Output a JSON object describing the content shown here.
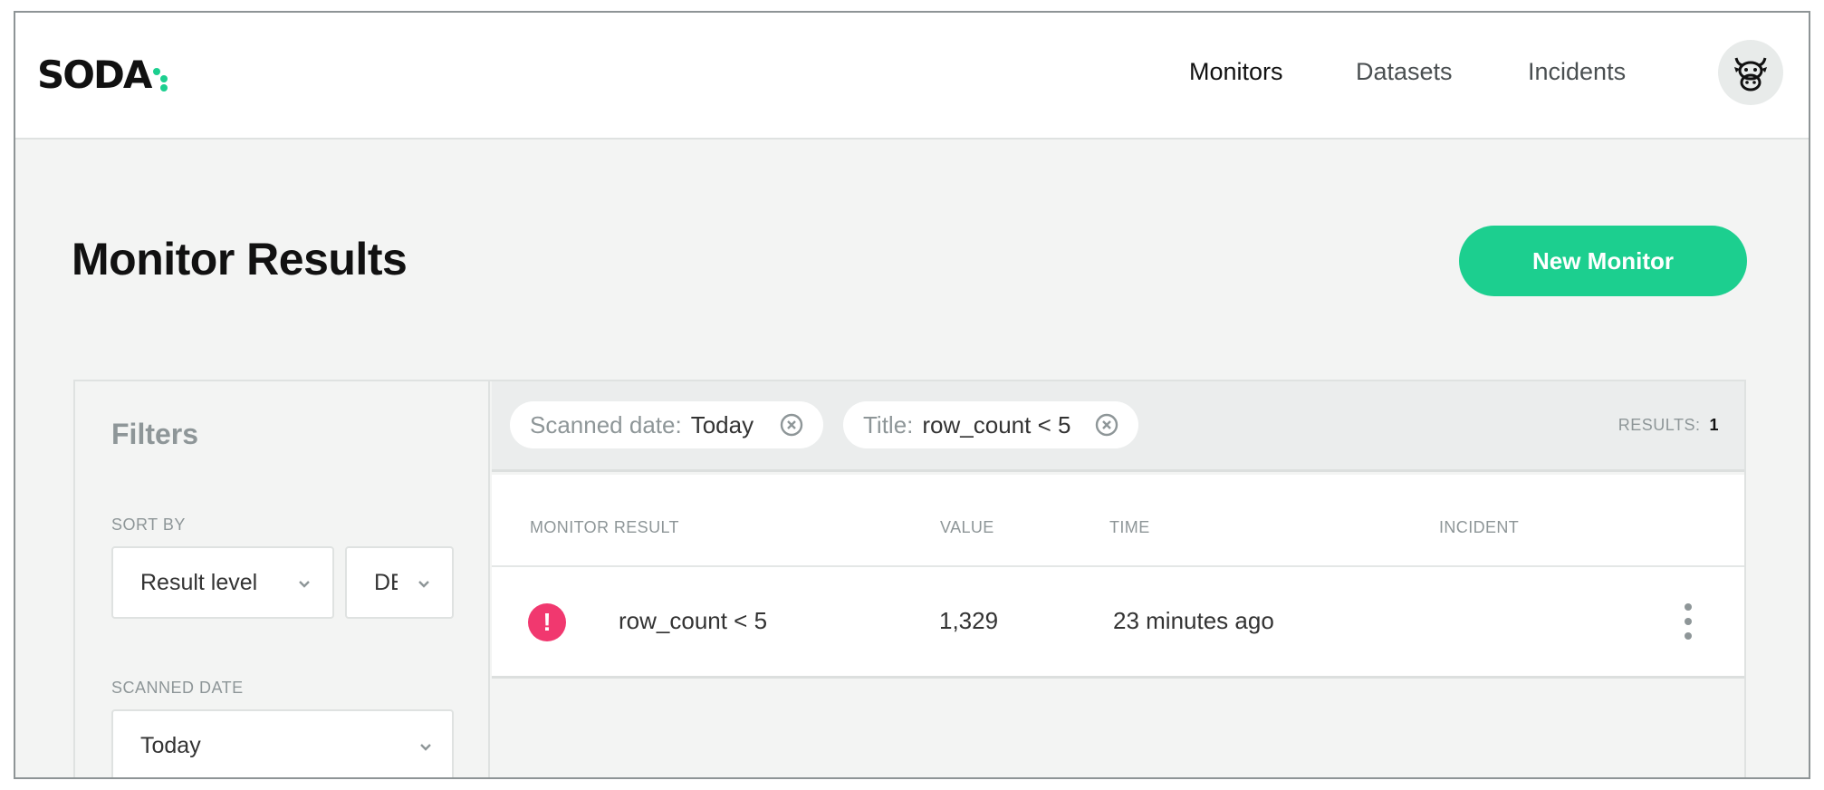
{
  "brand": {
    "logo_text": "SODA",
    "accent": "#1ccf8f"
  },
  "nav": {
    "items": [
      {
        "label": "Monitors",
        "active": true
      },
      {
        "label": "Datasets",
        "active": false
      },
      {
        "label": "Incidents",
        "active": false
      }
    ],
    "avatar_icon": "cow-icon"
  },
  "page": {
    "title": "Monitor Results",
    "new_button": "New Monitor",
    "button_color": "#1ccf8f"
  },
  "filters": {
    "title": "Filters",
    "sort_by": {
      "label": "SORT BY",
      "field": "Result level",
      "order": "DE"
    },
    "scanned_date": {
      "label": "SCANNED DATE",
      "value": "Today"
    }
  },
  "active_filters": [
    {
      "key": "Scanned date:",
      "value": "Today"
    },
    {
      "key": "Title:",
      "value": "row_count < 5"
    }
  ],
  "results": {
    "label": "RESULTS:",
    "count": "1"
  },
  "table": {
    "headers": {
      "monitor_result": "MONITOR RESULT",
      "value": "VALUE",
      "time": "TIME",
      "incident": "INCIDENT"
    },
    "rows": [
      {
        "status": "!",
        "status_color": "#f1386f",
        "monitor_result": "row_count < 5",
        "value": "1,329",
        "time": "23 minutes ago",
        "incident": ""
      }
    ]
  }
}
